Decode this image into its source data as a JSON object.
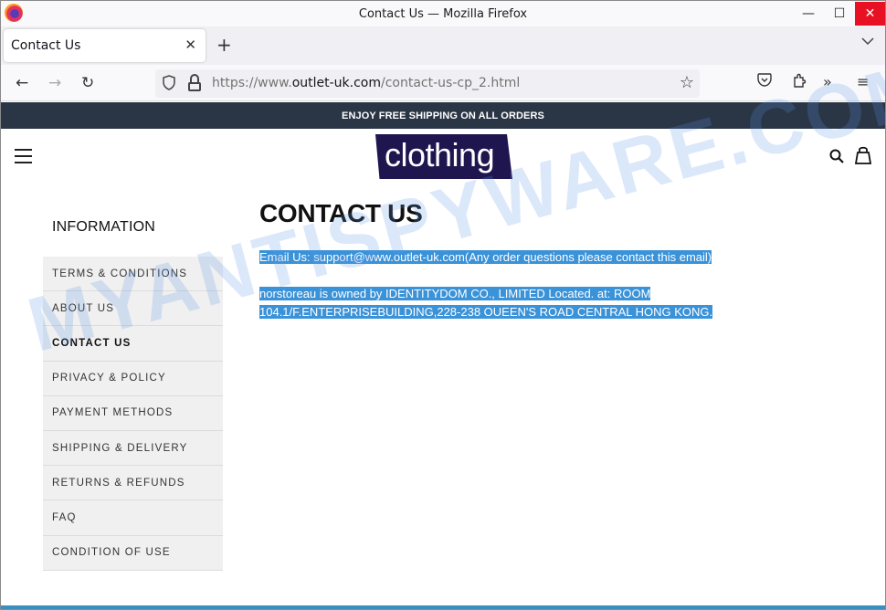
{
  "window": {
    "title": "Contact Us — Mozilla Firefox",
    "controls": {
      "minimize": "—",
      "maximize": "☐",
      "close": "✕"
    }
  },
  "tabs": [
    {
      "title": "Contact Us",
      "close_icon": "✕",
      "active": true
    }
  ],
  "tabbar": {
    "new_tab_icon": "+",
    "list_all_tabs_icon": "⌄"
  },
  "navbar": {
    "back_icon": "←",
    "forward_icon": "→",
    "reload_icon": "↻",
    "shield_icon": "⛉",
    "url_prefix": "https://www.",
    "url_domain": "outlet-uk.com",
    "url_path": "/contact-us-cp_2.html",
    "bookmark_icon": "☆",
    "pocket_icon": "♡",
    "extensions_icon": "⧉",
    "overflow_icon": "»",
    "menu_icon": "≡"
  },
  "site": {
    "promo_text": "ENJOY FREE SHIPPING ON ALL ORDERS",
    "logo_text": "clothing",
    "logo_color": "#1f1650"
  },
  "sidebar": {
    "title": "INFORMATION",
    "items": [
      {
        "label": "TERMS & CONDITIONS",
        "active": false
      },
      {
        "label": "ABOUT US",
        "active": false
      },
      {
        "label": "CONTACT US",
        "active": true
      },
      {
        "label": "PRIVACY & POLICY",
        "active": false
      },
      {
        "label": "PAYMENT METHODS",
        "active": false
      },
      {
        "label": "SHIPPING & DELIVERY",
        "active": false
      },
      {
        "label": "RETURNS & REFUNDS",
        "active": false
      },
      {
        "label": "FAQ",
        "active": false
      },
      {
        "label": "CONDITION OF USE",
        "active": false
      }
    ]
  },
  "main": {
    "title": "CONTACT US",
    "email_line": "Email Us: support@www.outlet-uk.com(Any order questions please contact this email)",
    "owner_line_1": "norstoreau is owned by IDENTITYDOM CO., LIMITED Located. at: ROOM",
    "owner_line_2": "104.1/F.ENTERPRISEBUILDING,228-238 OUEEN'S ROAD CENTRAL HONG KONG.",
    "selection_color": "#3a92d8"
  },
  "watermark": "MYANTISPYWARE.COM"
}
